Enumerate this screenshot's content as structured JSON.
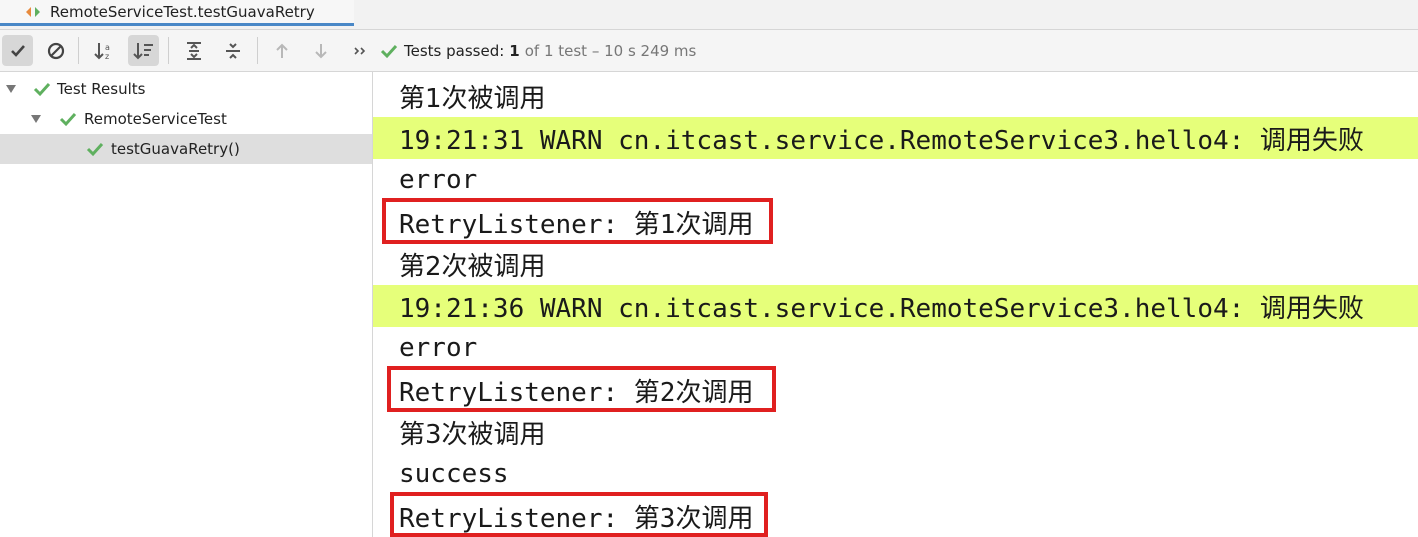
{
  "tab": {
    "title": "RemoteServiceTest.testGuavaRetry"
  },
  "toolbar": {
    "buttons": [
      {
        "name": "show-passed-icon",
        "active": true
      },
      {
        "name": "show-ignored-icon",
        "active": false
      },
      {
        "name": "sort-alphabetically-icon",
        "active": false
      },
      {
        "name": "sort-by-duration-icon",
        "active": true
      },
      {
        "name": "expand-all-icon",
        "active": false
      },
      {
        "name": "collapse-all-icon",
        "active": false
      },
      {
        "name": "previous-failed-icon",
        "active": false
      },
      {
        "name": "next-failed-icon",
        "active": false
      },
      {
        "name": "more-chevron-icon",
        "active": false
      }
    ]
  },
  "status": {
    "label": "Tests passed:",
    "passed": "1",
    "detail": "of 1 test – 10 s 249 ms"
  },
  "tree": {
    "items": [
      {
        "label": "Test Results"
      },
      {
        "label": "RemoteServiceTest"
      },
      {
        "label": "testGuavaRetry()"
      }
    ]
  },
  "console": {
    "lines": [
      {
        "text": "第1次被调用",
        "type": "cn"
      },
      {
        "text": "19:21:31 WARN cn.itcast.service.RemoteService3.hello4: 调用失败",
        "type": "warn"
      },
      {
        "text": "error",
        "type": "plain"
      },
      {
        "text": "RetryListener: 第1次调用",
        "type": "plain",
        "highlighted": true
      },
      {
        "text": "第2次被调用",
        "type": "cn"
      },
      {
        "text": "19:21:36 WARN cn.itcast.service.RemoteService3.hello4: 调用失败",
        "type": "warn"
      },
      {
        "text": "error",
        "type": "plain"
      },
      {
        "text": "RetryListener: 第2次调用",
        "type": "plain",
        "highlighted": true
      },
      {
        "text": "第3次被调用",
        "type": "cn"
      },
      {
        "text": "success",
        "type": "plain"
      },
      {
        "text": "RetryListener: 第3次调用",
        "type": "plain",
        "highlighted": true
      }
    ]
  },
  "colors": {
    "pass_green": "#5fb05f",
    "warn_bg": "#e6ff7a",
    "highlight_box": "#e02020",
    "tab_underline": "#4a88c7"
  }
}
